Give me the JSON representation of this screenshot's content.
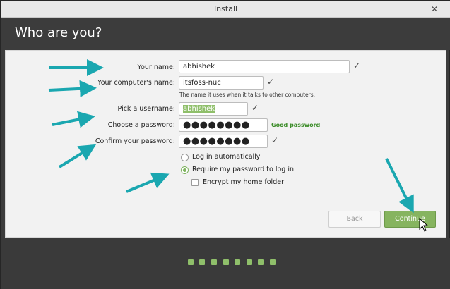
{
  "window": {
    "title": "Install",
    "close_glyph": "✕",
    "close_icon": "close-icon"
  },
  "header": {
    "heading": "Who are you?"
  },
  "form": {
    "name": {
      "label": "Your name:",
      "value": "abhishek",
      "valid_glyph": "✓"
    },
    "computer_name": {
      "label": "Your computer's name:",
      "value": "itsfoss-nuc",
      "hint": "The name it uses when it talks to other computers.",
      "valid_glyph": "✓"
    },
    "username": {
      "label": "Pick a username:",
      "value": "abhishek",
      "valid_glyph": "✓"
    },
    "password": {
      "label": "Choose a password:",
      "value": "●●●●●●●●",
      "strength": "Good password"
    },
    "confirm_password": {
      "label": "Confirm your password:",
      "value": "●●●●●●●●",
      "valid_glyph": "✓"
    },
    "login_options": [
      {
        "label": "Log in automatically",
        "selected": false
      },
      {
        "label": "Require my password to log in",
        "selected": true
      }
    ],
    "encrypt_home": {
      "label": "Encrypt my home folder",
      "checked": false
    }
  },
  "buttons": {
    "back": "Back",
    "continue": "Continue"
  },
  "progress": {
    "total_steps": 8
  },
  "colors": {
    "accent_green": "#86b45f",
    "annotation_arrow": "#1aa7b0",
    "dark_bg": "#3c3c3c"
  }
}
